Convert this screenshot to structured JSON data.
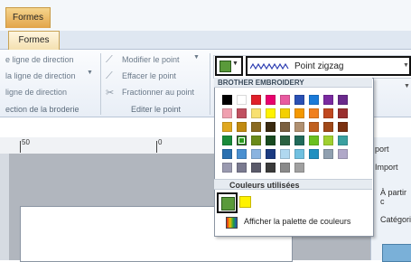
{
  "context_tab": "Formes",
  "active_tab": "Formes",
  "ribbon": {
    "direction_items": [
      "e ligne de direction",
      "la ligne de direction",
      "ligne de direction"
    ],
    "section_label": "ection de la broderie",
    "edit_items": [
      "Modifier le point",
      "Effacer le point",
      "Fractionner au point"
    ],
    "edit_group_label": "Editer le point",
    "stitch_type": "Point zigzag"
  },
  "ruler": {
    "labels": [
      "50",
      "0"
    ]
  },
  "side_panel": {
    "items": [
      "port",
      "Import",
      "À partir c",
      "Catégori"
    ]
  },
  "palette": {
    "header": "BROTHER EMBROIDERY",
    "rows": [
      [
        "#000000",
        "#ffffff",
        "#e0202a",
        "#e8006e",
        "#e85aa0",
        "#2a50b4",
        "#1a7ad8",
        "#7a2aa0",
        "#6a2a8c"
      ],
      [
        "#f0a0b0",
        "#c05060",
        "#f8e070",
        "#fff200",
        "#f4d000",
        "#f49800",
        "#f08020",
        "#c04820",
        "#9a3030"
      ],
      [
        "#e0a820",
        "#c08a10",
        "#8a6a20",
        "#3a2a10",
        "#7a6040",
        "#b09070",
        "#c06020",
        "#a04818",
        "#7a3010"
      ],
      [
        "#1a8a3a",
        "#2a9a20",
        "#6a8a1a",
        "#184a20",
        "#2a6040",
        "#206a5a",
        "#6ac020",
        "#a0d030",
        "#3aa0a0"
      ],
      [
        "#2a70b0",
        "#4a90d0",
        "#8ab4e0",
        "#1a3a80",
        "#b0d8f0",
        "#70c0e0",
        "#2090c0",
        "#90a0b0",
        "#b0a8c8"
      ],
      [
        "#9a9ab0",
        "#7a7a90",
        "#5a5a6a",
        "#3a3a3a",
        "#8a8a8a",
        "#a0a0a0"
      ]
    ],
    "used_header": "Couleurs utilisées",
    "used_colors": [
      "#5a9a3a",
      "#fff200"
    ],
    "show_palette_label": "Afficher la palette de couleurs"
  },
  "colors": {
    "accent_green": "#5a9a3a",
    "zigzag_line": "#2a3ab0"
  }
}
